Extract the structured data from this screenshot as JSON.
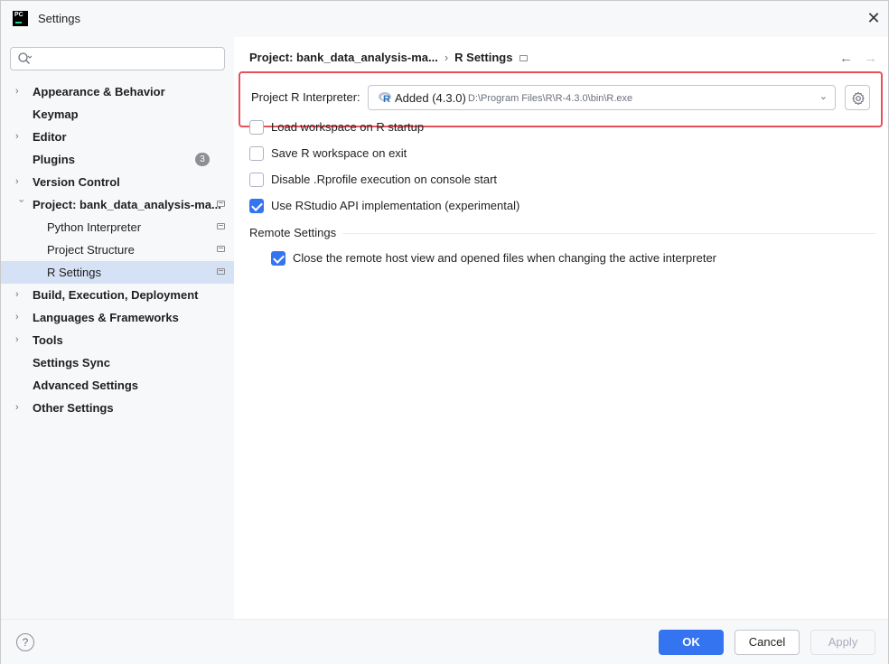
{
  "window": {
    "title": "Settings",
    "app_icon_text": "PC"
  },
  "search": {
    "placeholder": ""
  },
  "sidebar": {
    "items": [
      {
        "label": "Appearance & Behavior",
        "expandable": true
      },
      {
        "label": "Keymap",
        "expandable": false
      },
      {
        "label": "Editor",
        "expandable": true
      },
      {
        "label": "Plugins",
        "expandable": false,
        "badge": "3"
      },
      {
        "label": "Version Control",
        "expandable": true
      },
      {
        "label": "Project: bank_data_analysis-ma...",
        "expandable": true,
        "expanded": true
      },
      {
        "label": "Python Interpreter"
      },
      {
        "label": "Project Structure"
      },
      {
        "label": "R Settings",
        "selected": true
      },
      {
        "label": "Build, Execution, Deployment",
        "expandable": true
      },
      {
        "label": "Languages & Frameworks",
        "expandable": true
      },
      {
        "label": "Tools",
        "expandable": true
      },
      {
        "label": "Settings Sync",
        "expandable": false
      },
      {
        "label": "Advanced Settings",
        "expandable": false
      },
      {
        "label": "Other Settings",
        "expandable": true
      }
    ]
  },
  "breadcrumb": {
    "project": "Project: bank_data_analysis-ma...",
    "separator": "›",
    "page": "R Settings"
  },
  "interpreter": {
    "label": "Project R Interpreter:",
    "status": "Added (4.3.0)",
    "path": "D:\\Program Files\\R\\R-4.3.0\\bin\\R.exe"
  },
  "options": [
    {
      "label": "Load workspace on R startup",
      "checked": false
    },
    {
      "label": "Save R workspace on exit",
      "checked": false
    },
    {
      "label": "Disable .Rprofile execution on console start",
      "checked": false
    },
    {
      "label": "Use RStudio API implementation (experimental)",
      "checked": true
    }
  ],
  "remote": {
    "title": "Remote Settings",
    "option": {
      "label": "Close the remote host view and opened files when changing the active interpreter",
      "checked": true
    }
  },
  "footer": {
    "help": "?",
    "ok": "OK",
    "cancel": "Cancel",
    "apply": "Apply"
  },
  "colors": {
    "accent": "#3574f0",
    "highlight": "#e8505b",
    "selection": "#d5e1f5"
  }
}
